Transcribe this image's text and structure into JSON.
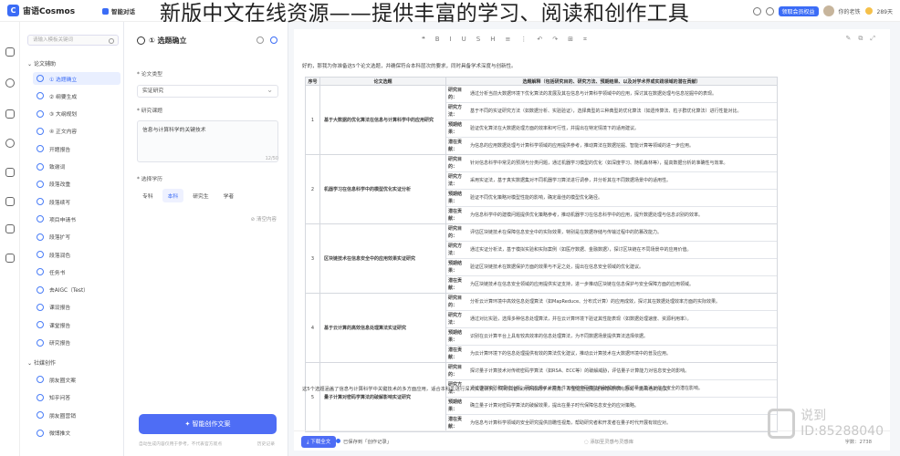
{
  "app": {
    "name": "宙语Cosmos",
    "nav": "智能对话"
  },
  "banner": "新版中文在线资源——提供丰富的学习、阅读和创作工具",
  "topright": {
    "badge": "领取会员权益",
    "user": "你的老铁",
    "points": "289天"
  },
  "sidebar": {
    "search_placeholder": "请输入模板关键词",
    "group1": "论文辅助",
    "items": [
      "① 选题确立",
      "② 纲要生成",
      "③ 大纲规划",
      "④ 正文内容",
      "开题报告",
      "致谢词",
      "段落改重",
      "段落续写",
      "项目申请书",
      "段落扩写",
      "段落润色",
      "任务书",
      "去AIGC（Test）",
      "课设报告",
      "课堂报告",
      "研究报告"
    ],
    "group2": "社媒创作",
    "items2": [
      "朋友圈文案",
      "知乎问答",
      "朋友圈营销",
      "微博推文"
    ]
  },
  "form": {
    "title": "① 选题确立",
    "type_label": "论文类型",
    "type_value": "实证研究",
    "topic_label": "研究课题",
    "topic_value": "信息与计算科学的关键技术",
    "counter": "12/50",
    "level_label": "选择学历",
    "levels": [
      "专科",
      "本科",
      "研究生",
      "学者"
    ],
    "clear": "清空内容",
    "generate": "智能创作文案",
    "foot_left": "自动生成内容仅用于参考，不代表官方观点",
    "foot_right": "历史记录"
  },
  "toolbar": {
    "tools": [
      "❝",
      "B",
      "I",
      "U",
      "S",
      "H",
      "≡",
      "⋮",
      "↶",
      "↷",
      "⊞",
      "⌗"
    ],
    "right": [
      "✎",
      "⧉",
      "⤢"
    ]
  },
  "document": {
    "intro": "好的，那我为你准备这5个论文选题，并确保符合本科层次的要求，同时具备学术深度与创新性。",
    "headers": [
      "序号",
      "论文选题",
      "选题解释（包括研究目的、研究方法、预期结果、以及对学术界或实践领域的潜在贡献）"
    ],
    "rows": [
      {
        "no": "1",
        "title": "基于大数据的优化算法在信息与计算科学中的应用研究",
        "subs": [
          [
            "研究目的：",
            "通过分析当前大数据环境下优化算法的发展及其在信息与计算科学领域中的应用，探讨其在数据处理与信息挖掘中的表现。"
          ],
          [
            "研究方法：",
            "基于不同的实证研究方法（如数据分析、实验验证），选择典型的三种典型的优化算法（如遗传算法、粒子群优化算法）进行性能对比。"
          ],
          [
            "预期结果：",
            "验证优化算法在大数据处理方面的效率和可行性，并提出在特定情境下的适用建议。"
          ],
          [
            "潜在贡献：",
            "为信息的应用数据处理与计算科学领域的应用提供参考，推动算法在数据挖掘、智能计算等领域的进一步应用。"
          ]
        ]
      },
      {
        "no": "2",
        "title": "机器学习在信息科学中的模型优化实证分析",
        "subs": [
          [
            "研究目的：",
            "针对信息科学中常见的预测与分类问题，通过机器学习模型的优化（如深度学习、随机森林等），提高数据分析的准确性与效率。"
          ],
          [
            "研究方法：",
            "采用实证法，基于真实数据集对不同机器学习算法进行调参，并分析其在不同数据场景中的适用性。"
          ],
          [
            "预期结果：",
            "验证不同优化策略对模型性能的影响，确定最佳的模型优化路径。"
          ],
          [
            "潜在贡献：",
            "为信息科学中的建模问题提供优化策略参考，推动机器学习在信息科学中的应用，提升数据处理与信息识别的效率。"
          ]
        ]
      },
      {
        "no": "3",
        "title": "区块链技术在信息安全中的应用效果实证研究",
        "subs": [
          [
            "研究目的：",
            "评估区块链技术在保障信息安全中的实际效果，特别是在数据存储与传输过程中的防篡改能力。"
          ],
          [
            "研究方法：",
            "通过实证分析法，基于模拟实验和实际案例（如医疗数据、金融数据），探讨区块链在不同场景中的应用价值。"
          ],
          [
            "预期结果：",
            "验证区块链技术在数据保护方面的效果与不足之处，提出在信息安全领域的优化建议。"
          ],
          [
            "潜在贡献：",
            "为区块链技术在信息安全领域的应用提供实证支持，进一步推动区块链在信息保护与安全保障方面的应用领域。"
          ]
        ]
      },
      {
        "no": "4",
        "title": "基于云计算的高效信息处理算法实证研究",
        "subs": [
          [
            "研究目的：",
            "分析云计算环境中高效信息处理算法（如MapReduce、分布式计算）的应用成效，探讨其在数据处理效率方面的实际效果。"
          ],
          [
            "研究方法：",
            "通过对比实验，选择多种信息处理算法，并在云计算环境下验证其性能表现（如数据处理速度、资源利用率）。"
          ],
          [
            "预期结果：",
            "识别在云计算平台上具有较高效率的信息处理算法，为不同数据场景提供算法选择依据。"
          ],
          [
            "潜在贡献：",
            "为云计算环境下的信息处理提供有效的算法优化建议，推动云计算技术在大数据环境中的普及应用。"
          ]
        ]
      },
      {
        "no": "5",
        "title": "量子计算对密码学算法的破解影响实证研究",
        "subs": [
          [
            "研究目的：",
            "探讨量子计算技术对传统密码学算法（如RSA、ECC等）的破解威胁，评估量子计算能力对信息安全的影响。"
          ],
          [
            "研究方法：",
            "通过模拟实验和理论分析，研究在量子计算条件下传统密码算法的破解难度，探讨量子算法对信息安全的潜在影响。"
          ],
          [
            "预期结果：",
            "确立量子计算对密码学算法的破解效果，提出在量子时代保障信息安全的应对策略。"
          ],
          [
            "潜在贡献：",
            "为信息与计算科学领域的安全研究提供前瞻性视角，帮助研究者和开发者在量子时代开展有效应对。"
          ]
        ]
      }
    ],
    "conclusion": "这5个选题涵盖了信息与计算科学中关键技术的多方面应用，适合本科生进行深入实证研究，同时具备相对新颖的学术视角。希望这些选题能够帮助你构思出一篇出色的论文！"
  },
  "bottom": {
    "download": "下载全文",
    "saved": "已保存到「创作记录」",
    "center": "添加至灵感与灵感库",
    "wordcount": "字数：2738"
  },
  "watermark": {
    "line1": "说到",
    "line2": "ID:85288040"
  }
}
